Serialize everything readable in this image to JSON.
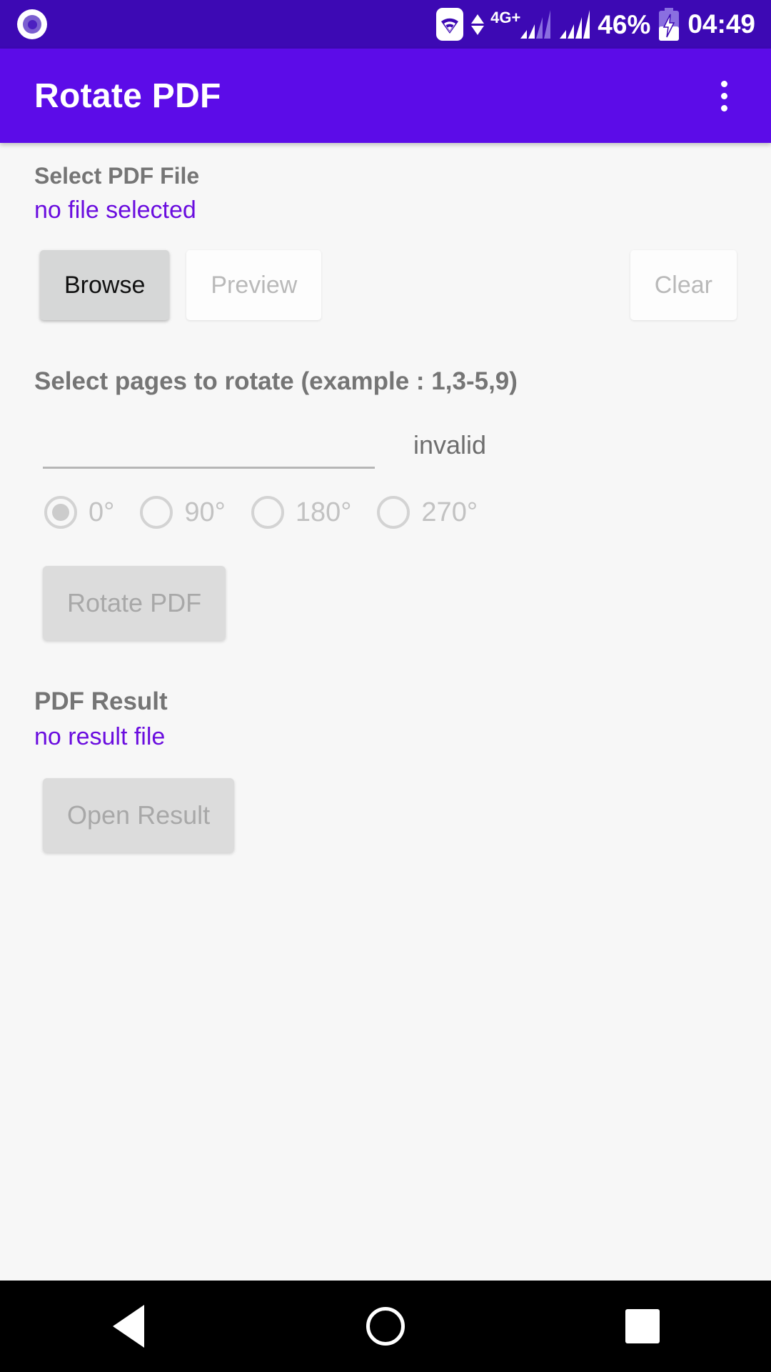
{
  "status_bar": {
    "app_icon": "circle-app-icon",
    "wifi_icon": "wifi-icon",
    "data_arrows_icon": "data-transfer-arrows-icon",
    "network_type": "4G+",
    "signal_icon_1": "signal-bars-icon",
    "signal_icon_2": "signal-bars-icon",
    "battery_percent": "46%",
    "battery_icon": "battery-charging-icon",
    "time": "04:49"
  },
  "app_bar": {
    "title": "Rotate PDF",
    "overflow_icon": "overflow-menu-icon"
  },
  "file_section": {
    "label": "Select PDF File",
    "status": "no file selected",
    "browse_label": "Browse",
    "preview_label": "Preview",
    "clear_label": "Clear"
  },
  "pages_section": {
    "label": "Select pages to rotate (example : 1,3-5,9)",
    "input_value": "",
    "input_placeholder": "",
    "validity": "invalid"
  },
  "rotation": {
    "options": [
      {
        "label": "0°",
        "selected": true
      },
      {
        "label": "90°",
        "selected": false
      },
      {
        "label": "180°",
        "selected": false
      },
      {
        "label": "270°",
        "selected": false
      }
    ],
    "action_label": "Rotate PDF"
  },
  "result_section": {
    "label": "PDF Result",
    "status": "no result file",
    "open_label": "Open Result"
  },
  "nav_bar": {
    "back_icon": "back-triangle-icon",
    "home_icon": "home-circle-icon",
    "recents_icon": "recents-square-icon"
  },
  "colors": {
    "status_bar_bg": "#3d09b4",
    "app_bar_bg": "#5c0ce8",
    "accent_purple": "#6a0ddf",
    "page_bg": "#f7f7f7",
    "label_gray": "#757575"
  }
}
